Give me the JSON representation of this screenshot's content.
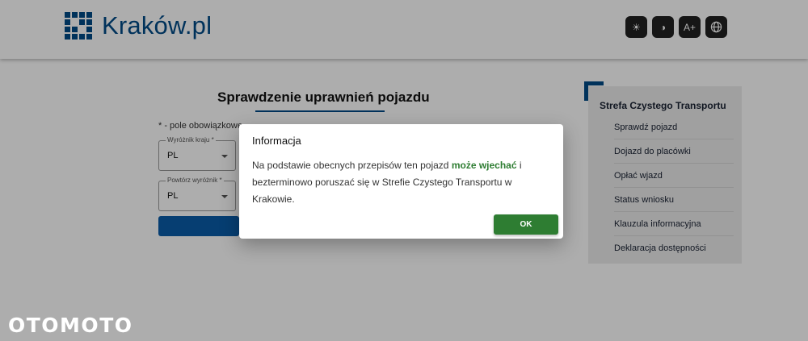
{
  "header": {
    "logo_text": "Kraków.pl",
    "a11y_buttons": [
      {
        "icon": "sun-icon",
        "glyph": "☀"
      },
      {
        "icon": "contrast-icon",
        "glyph": "◑"
      },
      {
        "icon": "font-size-icon",
        "glyph": "A+"
      },
      {
        "icon": "globe-icon",
        "glyph": "🌐"
      }
    ]
  },
  "form": {
    "title": "Sprawdzenie uprawnień pojazdu",
    "required_note": "* - pole obowiązkowe",
    "country_label": "Wyróżnik kraju *",
    "country_value": "PL",
    "repeat_label": "Powtórz wyróżnik *",
    "repeat_value": "PL"
  },
  "sidebar": {
    "title": "Strefa Czystego Transportu",
    "items": [
      {
        "label": "Sprawdź pojazd"
      },
      {
        "label": "Dojazd do placówki"
      },
      {
        "label": "Opłać wjazd"
      },
      {
        "label": "Status wniosku"
      },
      {
        "label": "Klauzula informacyjna"
      },
      {
        "label": "Deklaracja dostępności"
      }
    ]
  },
  "dialog": {
    "title": "Informacja",
    "body_before": "Na podstawie obecnych przepisów ten pojazd ",
    "body_highlight": "może wjechać",
    "body_after": " i bezterminowo poruszać się w Strefie Czystego Transportu w Krakowie.",
    "ok_label": "OK"
  },
  "watermark": "OTOMOTO",
  "colors": {
    "brand_blue": "#004b87",
    "success_green": "#2e7d32"
  }
}
